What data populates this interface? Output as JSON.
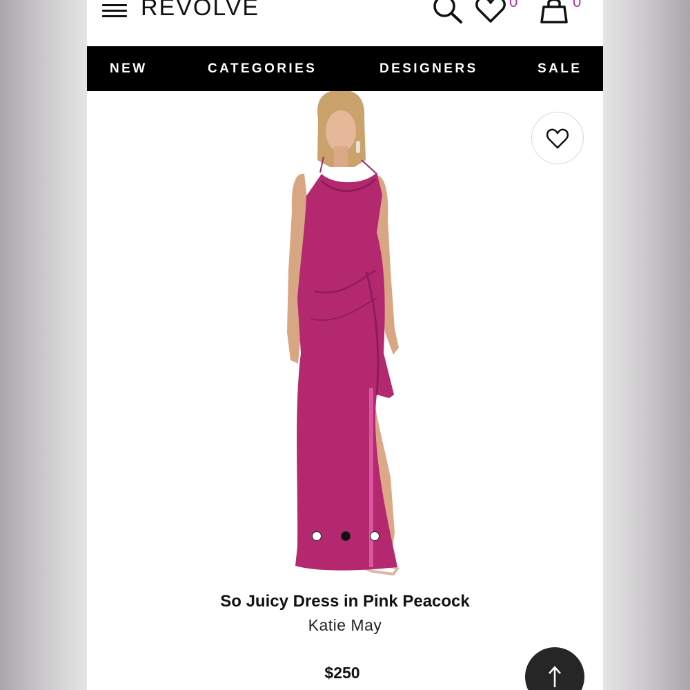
{
  "header": {
    "logo": "REVOLVE",
    "wishlist_count": "0",
    "bag_count": "0",
    "accent_color": "#c12a8e"
  },
  "nav": {
    "items": [
      "NEW",
      "CATEGORIES",
      "DESIGNERS",
      "SALE"
    ]
  },
  "carousel": {
    "slide_count": 3,
    "active_slide": 2
  },
  "product": {
    "title": "So Juicy Dress in Pink Peacock",
    "designer": "Katie May",
    "price": "$250",
    "dress_color": "#b3286f"
  },
  "icons": {
    "menu": "hamburger-icon",
    "search": "search-icon",
    "wishlist": "heart-icon",
    "bag": "shopping-bag-icon",
    "favorite": "heart-outline-icon",
    "back_to_top": "arrow-up-icon"
  }
}
